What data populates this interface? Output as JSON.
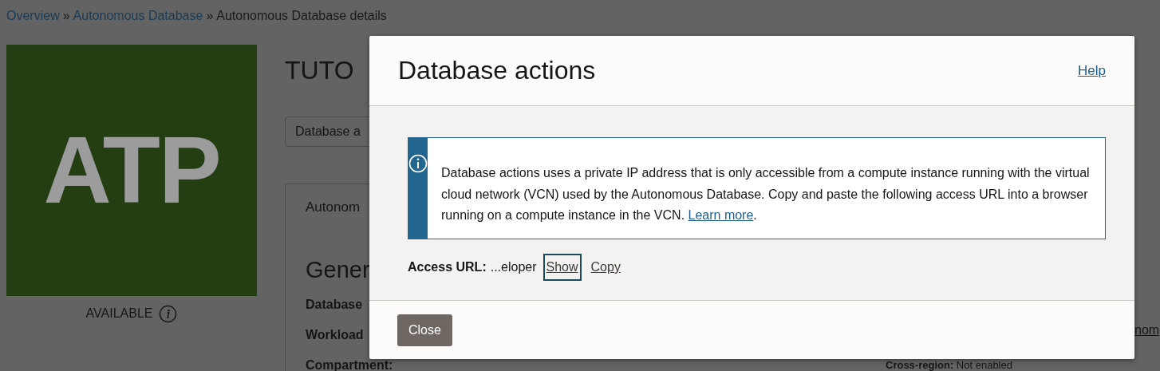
{
  "breadcrumb": {
    "separator": "»",
    "items": [
      {
        "label": "Overview",
        "link": true
      },
      {
        "label": "Autonomous Database",
        "link": true
      },
      {
        "label": "Autonomous Database details",
        "link": false
      }
    ]
  },
  "page": {
    "logo": "ATP",
    "status": "AVAILABLE",
    "title": "TUTO",
    "action_button": "Database a",
    "tab": "Autonom",
    "section_title": "Gener",
    "fields": [
      "Database",
      "Workload",
      "Compartment:"
    ],
    "right_link": "nom",
    "right_field": {
      "label": "Cross-region:",
      "value": "Not enabled"
    }
  },
  "modal": {
    "title": "Database actions",
    "help": "Help",
    "message": {
      "text": "Database actions uses a private IP address that is only accessible from a compute instance running with the virtual cloud network (VCN) used by the Autonomous Database. Copy and paste the following access URL into a browser running on a compute instance in the VCN. ",
      "link": "Learn more",
      "after": "."
    },
    "access_url": {
      "label": "Access URL:",
      "value": "...eloper"
    },
    "actions": [
      {
        "label": "Show",
        "focused": true
      },
      {
        "label": "Copy",
        "focused": false
      }
    ],
    "buttons": [
      "Close"
    ]
  }
}
